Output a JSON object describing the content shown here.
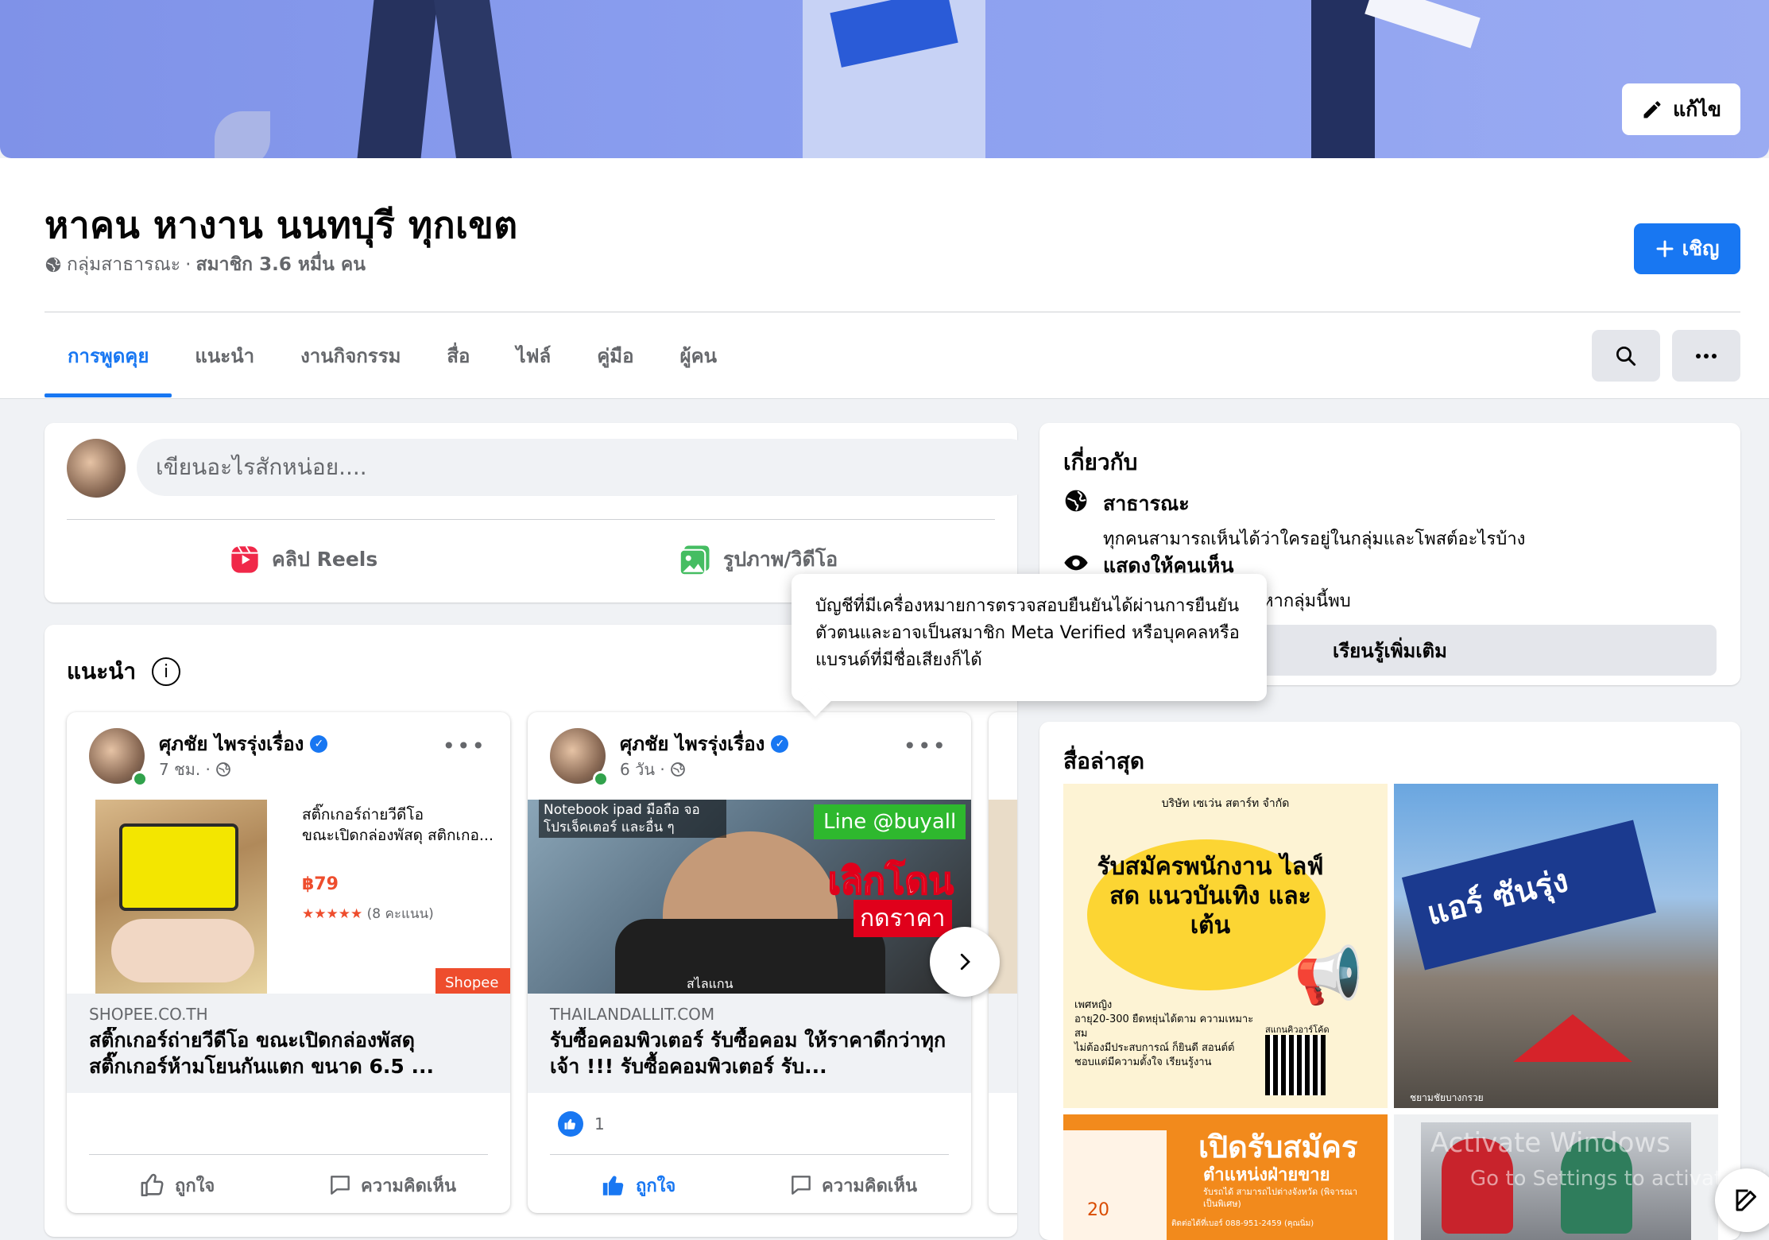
{
  "cover": {
    "edit_label": "แก้ไข"
  },
  "group": {
    "name": "หาคน หางาน นนทบุรี ทุกเขต",
    "privacy": "กลุ่มสาธารณะ",
    "separator": " · ",
    "members": "สมาชิก 3.6 หมื่น คน",
    "invite_label": "เชิญ"
  },
  "tabs": [
    {
      "label": "การพูดคุย",
      "active": true
    },
    {
      "label": "แนะนำ"
    },
    {
      "label": "งานกิจกรรม"
    },
    {
      "label": "สื่อ"
    },
    {
      "label": "ไฟล์"
    },
    {
      "label": "คู่มือ"
    },
    {
      "label": "ผู้คน"
    }
  ],
  "composer": {
    "placeholder": "เขียนอะไรสักหน่อย....",
    "reels_label": "คลิป Reels",
    "photo_label": "รูปภาพ/วิดีโอ"
  },
  "featured": {
    "title": "แนะนำ",
    "posts": [
      {
        "author": "ศุภชัย ไพรรุ่งเรื่อง",
        "time": "7 ชม. ·",
        "product_desc_line1": "สติ๊กเกอร์ถ่ายวีดีโอ",
        "product_desc_line2": "ขณะเปิดกล่องพัสดุ สติกเกอ...",
        "price": "฿79",
        "stars": "★★★★★",
        "rating_count": "(8 คะแนน)",
        "shop_badge": "Shopee",
        "domain": "SHOPEE.CO.TH",
        "link_title": "สติ๊กเกอร์ถ่ายวีดีโอ ขณะเปิดกล่องพัสดุ สติ๊กเกอร์ห้ามโยนกันแตก ขนาด 6.5 ...",
        "like_label": "ถูกใจ",
        "comment_label": "ความคิดเห็น"
      },
      {
        "author": "ศุภชัย ไพรรุ่งเรื่อง",
        "time": "6 วัน ·",
        "overlay_top": "Notebook ipad มือถือ จอ โปรเจ็คเตอร์ และอื่น ๆ",
        "overlay_line": "Line @buyall",
        "overlay_big": "เลิกโดน",
        "overlay_sub": "กดราคา",
        "overlay_bottom": "สไลแกน",
        "domain": "THAILANDALLIT.COM",
        "link_title": "รับซื้อคอมพิวเตอร์ รับซื้อคอม ให้ราคาดีกว่าทุกเจ้า !!! รับซื้อคอมพิวเตอร์ รับ...",
        "reaction_count": "1",
        "like_label": "ถูกใจ",
        "comment_label": "ความคิดเห็น"
      }
    ]
  },
  "about": {
    "title": "เกี่ยวกับ",
    "public_title": "สาธารณะ",
    "public_desc": "ทุกคนสามารถเห็นได้ว่าใครอยู่ในกลุ่มและโพสต์อะไรบ้าง",
    "visible_title": "แสดงให้คนเห็น",
    "visible_desc": "หากลุ่มนี้พบ",
    "learn_more": "เรียนรู้เพิ่มเติม"
  },
  "tooltip": {
    "text": "บัญชีที่มีเครื่องหมายการตรวจสอบยืนยันได้ผ่านการยืนยันตัวตนและอาจเป็นสมาชิก Meta Verified หรือบุคคลหรือแบรนด์ที่มีชื่อเสียงก็ได้"
  },
  "media": {
    "title": "สื่อล่าสุด",
    "thumb1": {
      "company": "บริษัท เซเว่น สตาร์ท จำกัด",
      "headline": "รับสมัครพนักงาน ไลฟ์สด แนวบันเทิง และเต้น",
      "bullets": [
        "เพศหญิง",
        "อายุ20-300 ยืดหยุ่นได้ตาม ความเหมาะสม",
        "ไม่ต้องมีประสบการณ์ ก็ยินดี สอนต์ต์ ชอบแต่มีความตั้งใจ เรียนรู้งาน"
      ],
      "qr_label": "สแกนคิวอาร์โค้ด"
    },
    "thumb2": {
      "sign_text": "แอร์ ซันรุ่ง",
      "caption": "ชยามชัยบางกรวย"
    },
    "thumb3": {
      "headline": "เปิดรับสมัคร",
      "sub": "ตำแหน่งฝ่ายขาย",
      "line": "รับรถได้ สามารถไปต่างจังหวัด (พิจารณาเป็นพิเศษ)",
      "contact": "ติดต่อได้ที่เบอร์ 088-951-2459 (คุณนิ่ม)",
      "badge": "20"
    }
  },
  "watermark": {
    "line1": "Activate Windows",
    "line2": "Go to Settings to activate Windows."
  },
  "colors": {
    "accent": "#1877f2",
    "page_bg": "#f0f2f5",
    "text_secondary": "#65676b"
  }
}
